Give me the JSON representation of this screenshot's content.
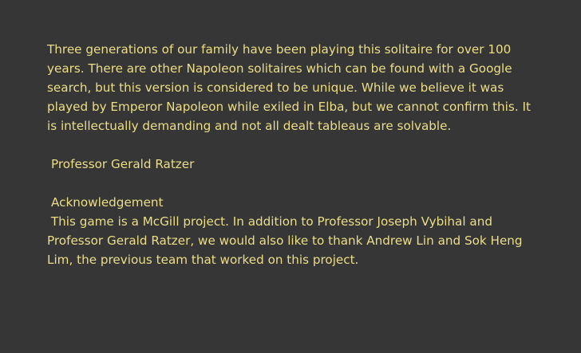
{
  "about": {
    "paragraph": "Three generations of our family have been playing this solitaire for over 100 years. There are other Napoleon solitaires which can be found with a Google search, but this version is considered to be unique. While we believe it was played by Emperor Napoleon while exiled in Elba, but we cannot confirm this. It is intellectually demanding and not all dealt tableaus are solvable.",
    "author": "Professor Gerald Ratzer"
  },
  "acknowledgement": {
    "heading": "Acknowledgement",
    "text": " This game is a McGill project. In addition to Professor Joseph Vybihal and Professor Gerald Ratzer, we would also like to thank Andrew Lin and Sok Heng Lim, the previous team that worked on this project."
  },
  "colors": {
    "background": "#363636",
    "text": "#ecde86"
  }
}
